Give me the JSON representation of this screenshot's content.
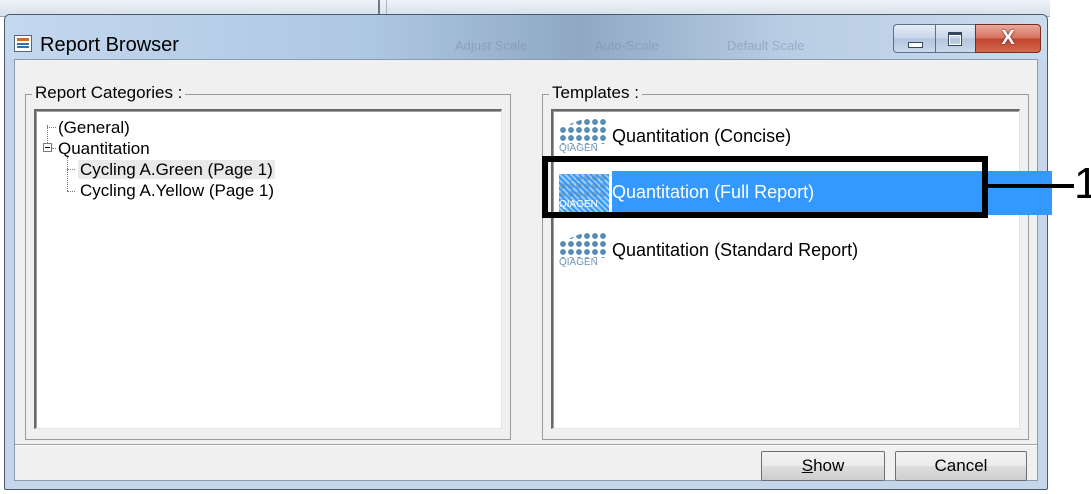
{
  "window": {
    "title": "Report Browser",
    "background_toolbar_ghosts": [
      "Adjust Scale",
      "Auto-Scale",
      "Default Scale"
    ],
    "close_glyph": "X"
  },
  "categories": {
    "legend": "Report Categories :",
    "items": [
      {
        "label": "(General)",
        "level": 0,
        "expanded": null
      },
      {
        "label": "Quantitation",
        "level": 0,
        "expanded": true
      },
      {
        "label": "Cycling A.Green (Page 1)",
        "level": 1,
        "selected": true
      },
      {
        "label": "Cycling A.Yellow (Page 1)",
        "level": 1,
        "selected": false
      }
    ]
  },
  "templates": {
    "legend": "Templates :",
    "icon_brand": "QIAGEN",
    "items": [
      {
        "label": "Quantitation (Concise)",
        "selected": false
      },
      {
        "label": "Quantitation (Full Report)",
        "selected": true
      },
      {
        "label": "Quantitation (Standard Report)",
        "selected": false
      }
    ]
  },
  "buttons": {
    "show_mnemonic": "S",
    "show_rest": "how",
    "cancel": "Cancel"
  },
  "annotation": {
    "number": "1"
  },
  "colors": {
    "selection": "#3399ff",
    "dialog_bg": "#f0f0f0",
    "close_button": "#c0442c"
  }
}
